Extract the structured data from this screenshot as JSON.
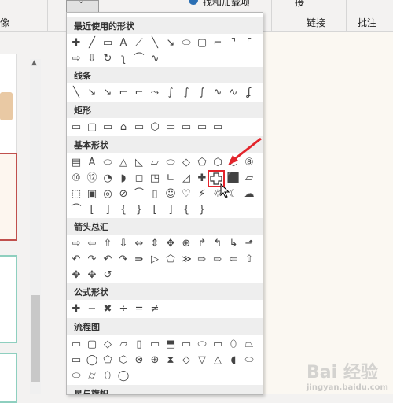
{
  "ribbon": {
    "left_label": "像",
    "top_label_1": "找和加载项",
    "top_label_2": "接",
    "group_link": "链接",
    "group_comment": "批注",
    "dropdown_glyph": "⌄"
  },
  "shapes_panel": {
    "sections": [
      {
        "title": "最近使用的形状"
      },
      {
        "title": "线条"
      },
      {
        "title": "矩形"
      },
      {
        "title": "基本形状"
      },
      {
        "title": "箭头总汇"
      },
      {
        "title": "公式形状"
      },
      {
        "title": "流程图"
      },
      {
        "title": "星与旗帜"
      }
    ],
    "rows": {
      "recent1": [
        "✚",
        "╱",
        "▭",
        "A",
        "⟋",
        "╲",
        "↘",
        "⬭",
        "▢",
        "⌐",
        "⌝",
        "⌜",
        "⌞",
        "{",
        "}"
      ],
      "recent2": [
        "⇨",
        "⇩",
        "↻",
        "ʅ",
        "⌒",
        "∿"
      ],
      "lines": [
        "╲",
        "↘",
        "↘",
        "⌐",
        "⌐",
        "⤳",
        "∫",
        "∫",
        "∫",
        "∿",
        "∿",
        "ʆ"
      ],
      "rects": [
        "▭",
        "▢",
        "▭",
        "⌂",
        "▭",
        "⬡",
        "▭",
        "▭",
        "▭",
        "▭"
      ],
      "basic1": [
        "▤",
        "A",
        "⬭",
        "△",
        "◺",
        "▱",
        "⬭",
        "◇",
        "⬠",
        "⬡",
        "⬡",
        "⑧"
      ],
      "basic2": [
        "⑩",
        "⑫",
        "◔",
        "◗",
        "◻",
        "◳",
        "∟",
        "◿",
        "✚",
        "⬡",
        "⬛",
        "▱"
      ],
      "basic3": [
        "⬚",
        "▣",
        "◎",
        "⊘",
        "⌒",
        "▯",
        "☺",
        "♡",
        "⚡",
        "☼",
        "☾",
        "☁"
      ],
      "basic4": [
        "⌒",
        "[",
        "]",
        "{",
        "}",
        "[",
        "]",
        "{",
        "}"
      ],
      "arrows1": [
        "⇨",
        "⇦",
        "⇧",
        "⇩",
        "⇔",
        "⇕",
        "✥",
        "⊕",
        "↱",
        "↰",
        "↳",
        "⬏"
      ],
      "arrows2": [
        "↶",
        "↷",
        "↶",
        "↷",
        "⇛",
        "▷",
        "⬠",
        "≫",
        "⇨",
        "⇨",
        "⇦",
        "⇧"
      ],
      "arrows3": [
        "✥",
        "✥",
        "↺"
      ],
      "formula": [
        "✚",
        "−",
        "✖",
        "÷",
        "═",
        "≠"
      ],
      "flow1": [
        "▭",
        "▢",
        "◇",
        "▱",
        "▯",
        "▭",
        "⬒",
        "▭",
        "⬭",
        "▭",
        "⬯",
        "⏢"
      ],
      "flow2": [
        "▭",
        "◯",
        "⬠",
        "⬡",
        "⊗",
        "⊕",
        "⧗",
        "◇",
        "▽",
        "△",
        "◖",
        "⬭"
      ],
      "flow3": [
        "⬭",
        "⌭",
        "⬯",
        "◯"
      ]
    }
  },
  "watermark": {
    "brand": "Bai 经验",
    "sub": "jingyan.baidu.com"
  }
}
